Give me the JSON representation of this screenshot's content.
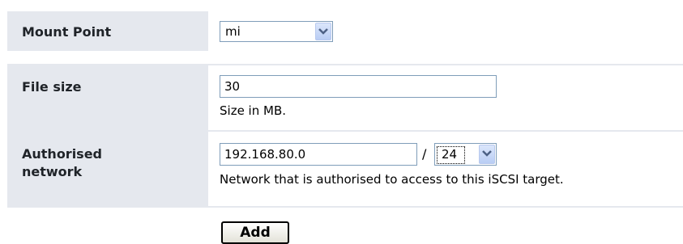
{
  "form": {
    "mount_point": {
      "label": "Mount Point",
      "selected": "mi"
    },
    "file_size": {
      "label": "File size",
      "value": "30",
      "hint": "Size in MB."
    },
    "authorised_network": {
      "label_line1": "Authorised",
      "label_line2": "network",
      "ip_value": "192.168.80.0",
      "separator": "/",
      "prefix_selected": "24",
      "hint": "Network that is authorised to access to this iSCSI target."
    },
    "add_button": "Add"
  },
  "colors": {
    "label_bg": "#e5e8ee",
    "input_border": "#7f9db9"
  },
  "icons": [
    "chevron-down-icon"
  ]
}
